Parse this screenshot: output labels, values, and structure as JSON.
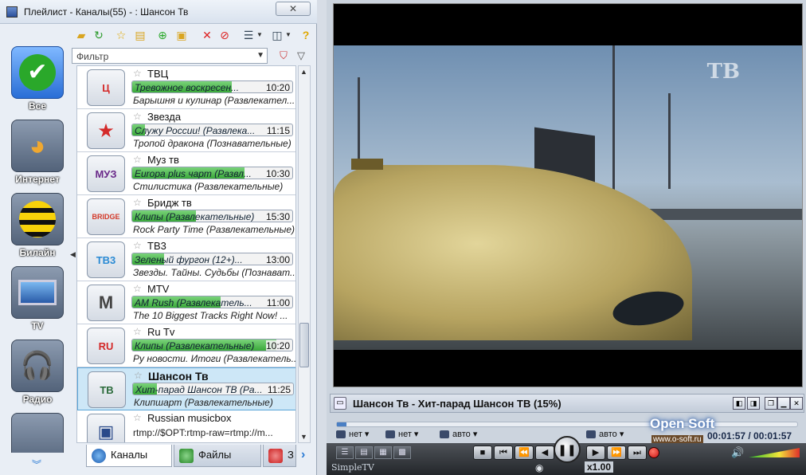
{
  "playlist": {
    "title": "Плейлист - Каналы(55) -  : Шансон Тв",
    "close_label": "✕",
    "filter_placeholder": "Фильтр",
    "categories": [
      {
        "label": "Все"
      },
      {
        "label": "Интернет"
      },
      {
        "label": "Билайн"
      },
      {
        "label": "TV"
      },
      {
        "label": "Радио"
      }
    ],
    "channels": [
      {
        "name": "ТВЦ",
        "now": "Тревожное воскресен...",
        "time": "10:20",
        "next": "Барышня и кулинар (Развлекател...",
        "progress": 0.62,
        "logo": "Ц",
        "logo_color": "#d42a2a"
      },
      {
        "name": "Звезда",
        "now": "Служу России! (Развлека...",
        "time": "11:15",
        "next": "Тропой дракона (Познавательные)",
        "progress": 0.08,
        "logo": "★",
        "logo_color": "#d42a2a"
      },
      {
        "name": "Муз тв",
        "now": "Europa plus чарт (Развл...",
        "time": "10:30",
        "next": "Стилистика (Развлекательные)",
        "progress": 0.7,
        "logo": "МУЗ",
        "logo_color": "#6a2a8a"
      },
      {
        "name": "Бридж тв",
        "now": "Клипы (Развлекательные)",
        "time": "15:30",
        "next": "Rock Party Time (Развлекательные)",
        "progress": 0.4,
        "logo": "BRIDGE",
        "logo_color": "#d43a2a"
      },
      {
        "name": "ТВ3",
        "now": "Зеленый фургон (12+)...",
        "time": "13:00",
        "next": "Звезды. Тайны. Судьбы (Познават...",
        "progress": 0.2,
        "logo": "ТВ3",
        "logo_color": "#2a8ad4"
      },
      {
        "name": "MTV",
        "now": "AM Rush (Развлекатель...",
        "time": "11:00",
        "next": "The 10 Biggest Tracks Right Now! ...",
        "progress": 0.55,
        "logo": "M",
        "logo_color": "#444"
      },
      {
        "name": "Ru Tv",
        "now": "Клипы (Развлекательные)",
        "time": "10:20",
        "next": "Ру новости. Итоги (Развлекатель...",
        "progress": 0.9,
        "logo": "RU",
        "logo_color": "#d42a2a"
      },
      {
        "name": "Шансон Тв",
        "now": "Хит-парад Шансон ТВ (Ра...",
        "time": "11:25",
        "next": "Клипшарт (Развлекательные)",
        "progress": 0.15,
        "logo": "ТВ",
        "logo_color": "#2a6a3a"
      },
      {
        "name": "Russian musicbox",
        "plain": "rtmp://$OPT:rtmp-raw=rtmp://m...",
        "logo": "▣",
        "logo_color": "#2a4a8a"
      }
    ],
    "tabs": [
      {
        "label": "Каналы"
      },
      {
        "label": "Файлы"
      },
      {
        "label": "З"
      }
    ]
  },
  "player": {
    "now_playing": "Шансон Тв - Хит-парад Шансон ТВ (15%)",
    "seek_fraction": 0.02,
    "options": [
      {
        "label": "нет"
      },
      {
        "label": "нет"
      },
      {
        "label": "авто"
      },
      {
        "label": "авто"
      }
    ],
    "brand_name": "Open Soft",
    "brand_url": "www.o-soft.ru",
    "time_display": "00:01:57 / 00:01:57",
    "app_name": "SimpleTV",
    "speed": "x1.00",
    "video_logo": "ТВ"
  }
}
